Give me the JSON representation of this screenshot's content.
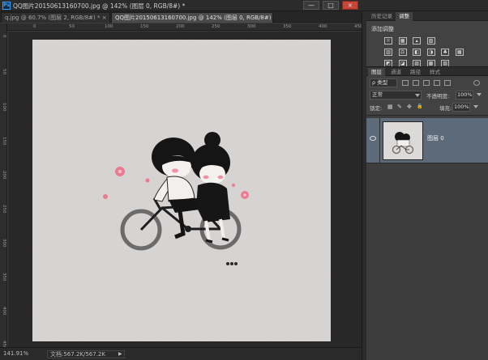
{
  "window": {
    "logo": "Ps",
    "title": "QQ图片20150613160700.jpg @ 142% (图层 0, RGB/8#) *",
    "min_glyph": "—",
    "max_glyph": "□",
    "close_glyph": "×"
  },
  "tabs": [
    {
      "label": "q.jpg @ 60.7% (图层 2, RGB/8#) *",
      "close": "×"
    },
    {
      "label": "QQ图片20150613160700.jpg @ 142% (图层 0, RGB/8#) *",
      "close": "×"
    }
  ],
  "ruler": {
    "top_ticks": [
      "0",
      "50",
      "100",
      "150",
      "200",
      "250",
      "300",
      "350",
      "400",
      "450"
    ],
    "left_ticks": [
      "0",
      "50",
      "100",
      "150",
      "200",
      "250",
      "300",
      "350",
      "400",
      "450"
    ]
  },
  "artwork": {
    "background_color": "#d8d5d3",
    "accent_color": "#ec7a90",
    "ink_color": "#1b1b1b"
  },
  "status": {
    "zoom": "141.91%",
    "doc_size": "文档:567.2K/567.2K",
    "arrow": "▶"
  },
  "adjustments_panel": {
    "tabs": [
      "历史记录",
      "调整"
    ],
    "active_tab": 1,
    "title": "添加调整",
    "rows": [
      [
        "☼",
        "▦",
        "▴",
        "▨"
      ],
      [
        "▥",
        "⚖",
        "◧",
        "◑",
        "♣",
        "▦"
      ],
      [
        "◩",
        "◪",
        "▨",
        "▩",
        "▧"
      ]
    ]
  },
  "layers_panel": {
    "tabs": [
      "图层",
      "通道",
      "路径",
      "样式"
    ],
    "active_tab": 0,
    "filter_label": "ρ 类型",
    "blend_mode": "正常",
    "opacity_label": "不透明度:",
    "opacity_value": "100%",
    "lock_label": "锁定:",
    "lock_icons": [
      "▦",
      "✎",
      "✥",
      "🔒"
    ],
    "fill_label": "填充:",
    "fill_value": "100%",
    "layers": [
      {
        "name": "图层 0",
        "selected": true,
        "visible": true
      }
    ]
  }
}
